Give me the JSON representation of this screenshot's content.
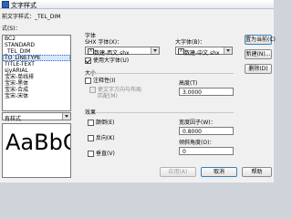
{
  "window": {
    "title": "文字样式"
  },
  "current_style": {
    "label": "前文字样式：",
    "value": "_TEL_DIM"
  },
  "styles": {
    "label": "式(S)：",
    "items": [
      {
        "name": "BC2",
        "selected": false
      },
      {
        "name": "STANDARD",
        "selected": false
      },
      {
        "name": "_TEL_DIM",
        "selected": false
      },
      {
        "name": "TO_LINETYPE",
        "selected": true
      },
      {
        "name": "TITLE-TEXT",
        "selected": false
      },
      {
        "name": "sjyARIAL",
        "selected": false
      },
      {
        "name": "宝宋-单线排",
        "selected": false
      },
      {
        "name": "宝宋-黑体",
        "selected": false
      },
      {
        "name": "宝宋-合成",
        "selected": false
      },
      {
        "name": "宝宋-宋体",
        "selected": false
      }
    ]
  },
  "filter": {
    "value": "有样式"
  },
  "font": {
    "group_label": "字体",
    "shx_label": "SHX 字体(X)：",
    "shx_value": "数建-西文.shx",
    "bigfont_label": "大字体(B)：",
    "bigfont_value": "数建-中文.shx",
    "use_bigfont_label": "使用大字体(U)",
    "use_bigfont_checked": true
  },
  "size": {
    "group_label": "大小",
    "annotative_label": "注释性(I)",
    "annotative_checked": false,
    "match_orientation_label": "使文字方向与布局",
    "match_orientation_label2": "匹配(M)",
    "height_label": "高度(T)",
    "height_value": "3.0000"
  },
  "effects": {
    "group_label": "效果",
    "upside_down_label": "颠倒(E)",
    "backwards_label": "反向(K)",
    "vertical_label": "垂直(V)",
    "width_factor_label": "宽度因子(W)：",
    "width_factor_value": "0.8000",
    "oblique_label": "倾斜角度(O)：",
    "oblique_value": "0"
  },
  "buttons": {
    "set_current": "置为当前(C)",
    "new": "新建(N)...",
    "delete": "删除(D)",
    "apply": "应用(A)",
    "cancel": "取消",
    "help": "帮助"
  },
  "preview": {
    "text": "AaBbCcD"
  }
}
